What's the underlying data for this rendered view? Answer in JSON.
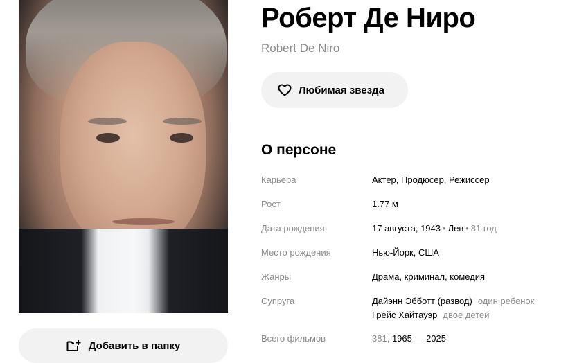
{
  "person": {
    "name": "Роберт Де Ниро",
    "original_name": "Robert De Niro"
  },
  "buttons": {
    "favorite": "Любимая звезда",
    "add_to_folder": "Добавить в папку"
  },
  "about": {
    "title": "О персоне",
    "rows": [
      {
        "label": "Карьера",
        "value": "Актер, Продюсер, Режиссер"
      },
      {
        "label": "Рост",
        "value": "1.77 м"
      },
      {
        "label": "Дата рождения",
        "date": "17 августа, 1943",
        "sign": "Лев",
        "age": "81 год"
      },
      {
        "label": "Место рождения",
        "value": "Нью-Йорк, США"
      },
      {
        "label": "Жанры",
        "value": "Драма, криминал, комедия"
      },
      {
        "label": "Супруга",
        "spouses": [
          {
            "name": "Дайэнн Эбботт (развод)",
            "note": "один ребенок"
          },
          {
            "name": "Грейс Хайтауэр",
            "note": "двое детей"
          }
        ]
      },
      {
        "label": "Всего фильмов",
        "count": "381,",
        "years": "1965 — 2025"
      }
    ]
  },
  "icons": {
    "favorite": "heart-outline-icon",
    "add_folder": "folder-plus-icon"
  }
}
